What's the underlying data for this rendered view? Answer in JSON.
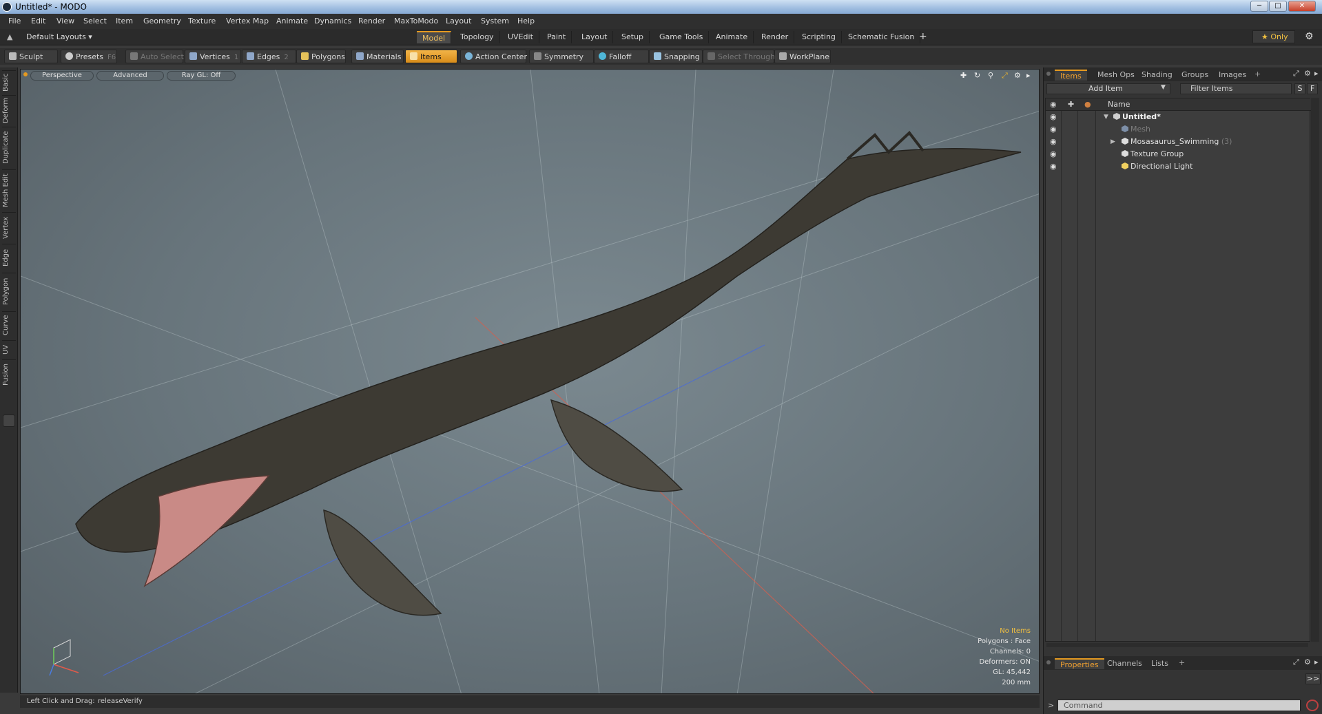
{
  "window": {
    "title": "Untitled* - MODO",
    "min": "─",
    "max": "□",
    "close": "✕"
  },
  "menu": [
    "File",
    "Edit",
    "View",
    "Select",
    "Item",
    "Geometry",
    "Texture",
    "Vertex Map",
    "Animate",
    "Dynamics",
    "Render",
    "MaxToModo",
    "Layout",
    "System",
    "Help"
  ],
  "layoutbar": {
    "layout_select": "Default Layouts ▾",
    "tabs": [
      "Model",
      "Topology",
      "UVEdit",
      "Paint",
      "Layout",
      "Setup",
      "Game Tools",
      "Animate",
      "Render",
      "Scripting",
      "Schematic Fusion"
    ],
    "active_tab": "Model",
    "add": "+",
    "only": "★ Only",
    "gear": "⚙"
  },
  "toolbar": {
    "sculpt": "Sculpt",
    "presets": "Presets",
    "presets_key": "F6",
    "auto_select": "Auto Select",
    "vertices": "Vertices",
    "vertices_key": "1",
    "edges": "Edges",
    "edges_key": "2",
    "polygons": "Polygons",
    "materials": "Materials",
    "items": "Items",
    "action_center": "Action Center",
    "symmetry": "Symmetry",
    "falloff": "Falloff",
    "snapping": "Snapping",
    "select_through": "Select Through",
    "workplane": "WorkPlane"
  },
  "left_tabs": [
    "Basic",
    "Deform",
    "Duplicate",
    "Mesh Edit",
    "Vertex",
    "Edge",
    "Polygon",
    "Curve",
    "UV",
    "Fusion"
  ],
  "viewport": {
    "perspective": "Perspective",
    "advanced": "Advanced",
    "raygl": "Ray GL: Off",
    "info": {
      "no_items": "No Items",
      "polygons": "Polygons : Face",
      "channels": "Channels: 0",
      "deformers": "Deformers: ON",
      "gl": "GL: 45,442",
      "size": "200 mm"
    }
  },
  "status": {
    "hint": "Left Click and Drag:",
    "action": "releaseVerify"
  },
  "items_panel": {
    "tabs": [
      "Items",
      "Mesh Ops",
      "Shading",
      "Groups",
      "Images"
    ],
    "active_tab": "Items",
    "add": "+",
    "add_item": "Add Item",
    "filter": "Filter Items",
    "s": "S",
    "f": "F",
    "col_name": "Name",
    "tree": [
      {
        "label": "Untitled*",
        "bold": true,
        "count": ""
      },
      {
        "label": "Mesh",
        "dim": true,
        "count": ""
      },
      {
        "label": "Mosasaurus_Swimming",
        "count": "(3)"
      },
      {
        "label": "Texture Group",
        "count": ""
      },
      {
        "label": "Directional Light",
        "count": ""
      }
    ]
  },
  "props_panel": {
    "tabs": [
      "Properties",
      "Channels",
      "Lists"
    ],
    "active_tab": "Properties",
    "add": "+",
    "expand": ">>",
    "command_placeholder": "Command"
  }
}
